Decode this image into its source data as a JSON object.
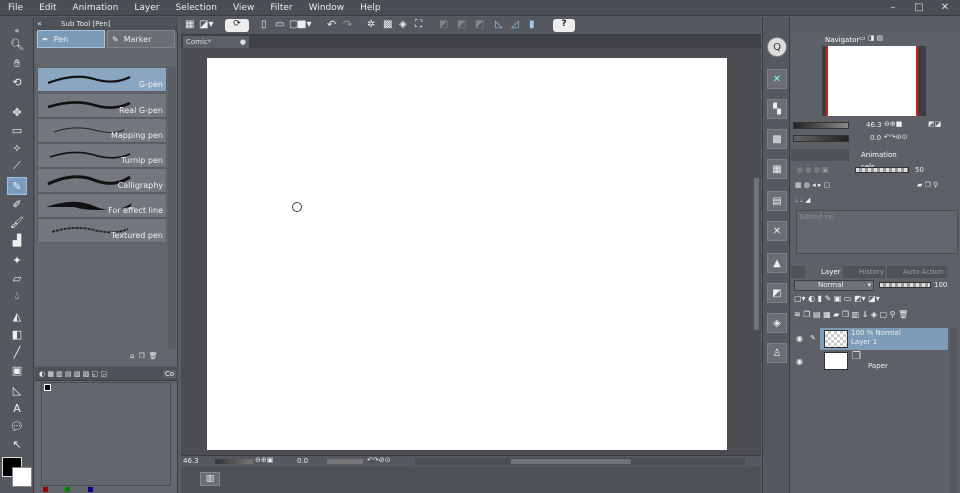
{
  "menu": [
    "File",
    "Edit",
    "Animation",
    "Layer",
    "Selection",
    "View",
    "Filter",
    "Window",
    "Help"
  ],
  "subtool": {
    "title": "Sub Tool [Pen]",
    "tabs": [
      "Pen",
      "Marker"
    ],
    "brushes": [
      "G-pen",
      "Real G-pen",
      "Mapping pen",
      "Turnip pen",
      "Calligraphy",
      "For effect line",
      "Textured pen"
    ]
  },
  "color_panel": {
    "tab_label": "Co"
  },
  "document": {
    "tab": "Comic*"
  },
  "status": {
    "zoom": "46.3",
    "rotation": "0.0"
  },
  "navigator": {
    "title": "Navigator",
    "zoom": "46.3",
    "rotation": "0.0"
  },
  "animation": {
    "title": "Animation cels",
    "value": "50",
    "placeholder": "Edited cel"
  },
  "layers": {
    "tabs": [
      "Layer",
      "History",
      "Auto Action"
    ],
    "blend_mode": "Normal",
    "opacity": "100",
    "items": [
      {
        "info": "100 % Normal",
        "name": "Layer 1"
      },
      {
        "name": "Paper"
      }
    ]
  },
  "colors": {
    "accent": "#7e9cb8",
    "background": "#5a5d63",
    "nav_frame": "#cc2222"
  }
}
